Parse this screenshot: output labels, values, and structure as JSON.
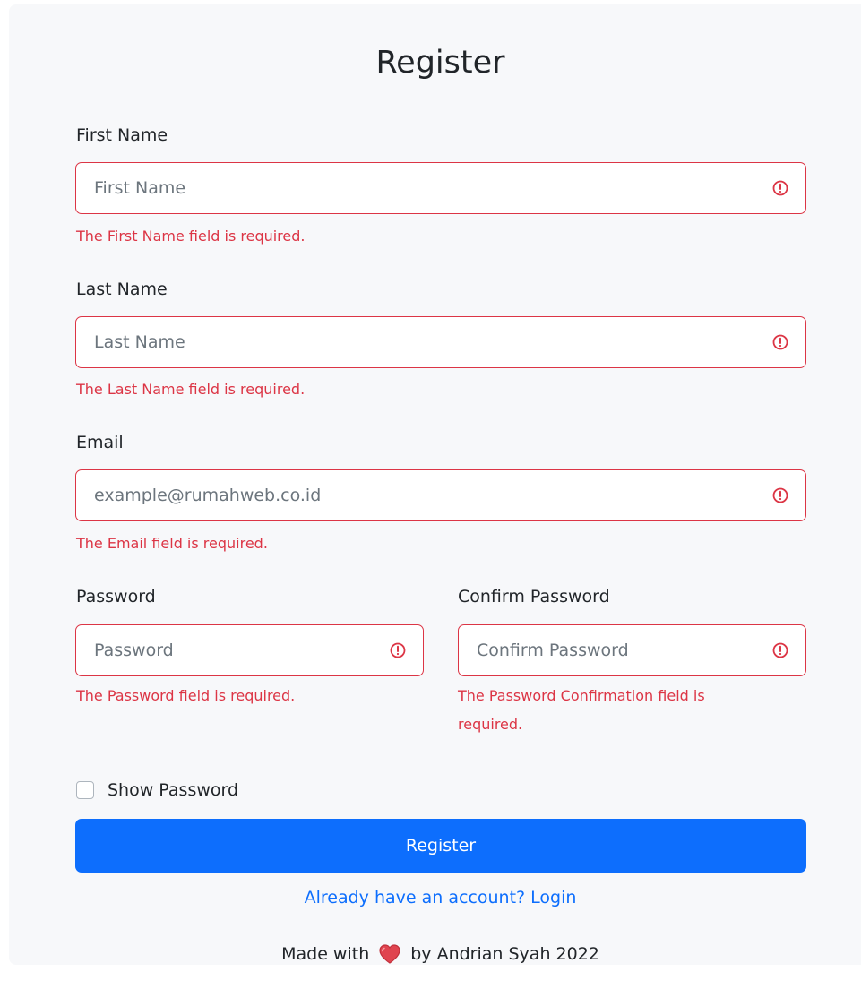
{
  "form": {
    "title": "Register",
    "first_name": {
      "label": "First Name",
      "placeholder": "First Name",
      "error": "The First Name field is required."
    },
    "last_name": {
      "label": "Last Name",
      "placeholder": "Last Name",
      "error": "The Last Name field is required."
    },
    "email": {
      "label": "Email",
      "placeholder": "example@rumahweb.co.id",
      "error": "The Email field is required."
    },
    "password": {
      "label": "Password",
      "placeholder": "Password",
      "error": "The Password field is required."
    },
    "confirm_password": {
      "label": "Confirm Password",
      "placeholder": "Confirm Password",
      "error_line1": "The Password Confirmation field is",
      "error_line2": "required."
    },
    "show_password_label": "Show Password",
    "submit_label": "Register",
    "login_link": "Already have an account? Login",
    "footer_prefix": "Made with",
    "footer_suffix": "by Andrian Syah 2022"
  },
  "icons": {
    "field_error": "alert-circle-icon",
    "footer": "heart-icon"
  },
  "colors": {
    "error": "#dc3545",
    "primary": "#0d6efd",
    "card_bg": "#f7f8fa"
  }
}
